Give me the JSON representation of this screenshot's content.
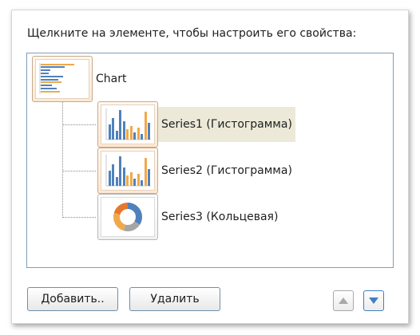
{
  "instruction": "Щелкните на элементе, чтобы настроить его свойства:",
  "tree": {
    "root": {
      "label": "Chart",
      "icon": "chart-bar-icon"
    },
    "series": [
      {
        "label": "Series1 (Гистограмма)",
        "icon": "column-chart-icon",
        "selected": true
      },
      {
        "label": "Series2 (Гистограмма)",
        "icon": "column-chart-icon",
        "selected": false
      },
      {
        "label": "Series3 (Кольцевая)",
        "icon": "doughnut-chart-icon",
        "selected": false
      }
    ]
  },
  "buttons": {
    "add": "Добавить..",
    "delete": "Удалить",
    "move_up": "arrow-up-icon",
    "move_down": "arrow-down-icon"
  },
  "colors": {
    "selection": "#ece9d8",
    "bar_blue": "#4f81bd",
    "bar_orange": "#f0a94a",
    "accent_blue": "#3f7fc4"
  }
}
